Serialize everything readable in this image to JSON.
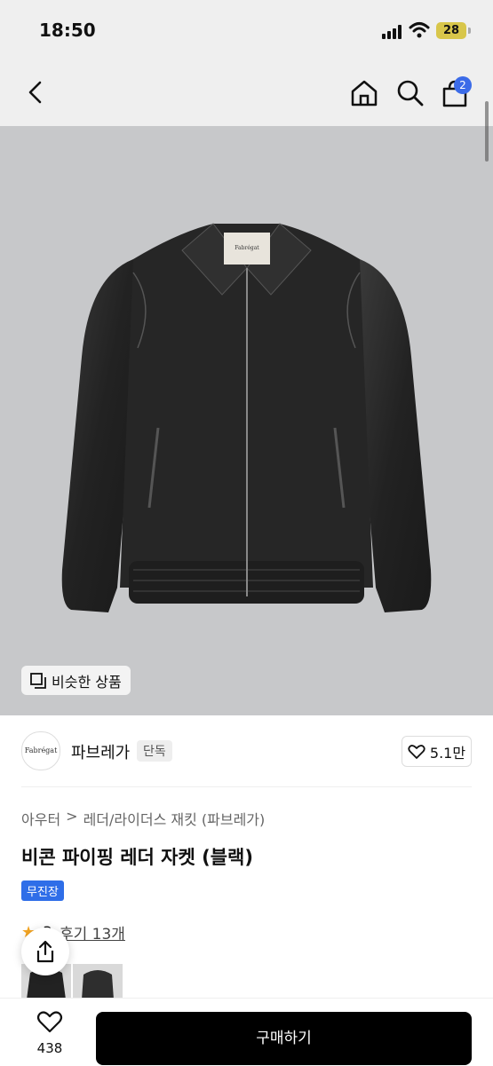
{
  "status_bar": {
    "time": "18:50",
    "battery": "28"
  },
  "nav": {
    "cart_count": "2"
  },
  "similar_button": {
    "label": "비슷한 상품"
  },
  "brand": {
    "logo_text": "Fabrégat",
    "name": "파브레가",
    "badge": "단독",
    "likes": "5.1만"
  },
  "breadcrumb": {
    "root": "아우터",
    "separator": ">",
    "category": "레더/라이더스 재킷 (파브레가)"
  },
  "product": {
    "title": "비콘 파이핑 레더 자켓 (블랙)",
    "tag": "무진장",
    "rating": "3",
    "reviews": "후기 13개"
  },
  "product_image": {
    "label_text": "Fabrégat"
  },
  "bottom": {
    "wish_count": "438",
    "buy_label": "구매하기"
  },
  "colors": {
    "accent": "#2f6ee8",
    "buy": "#000000",
    "badge": "#3b6be8"
  }
}
